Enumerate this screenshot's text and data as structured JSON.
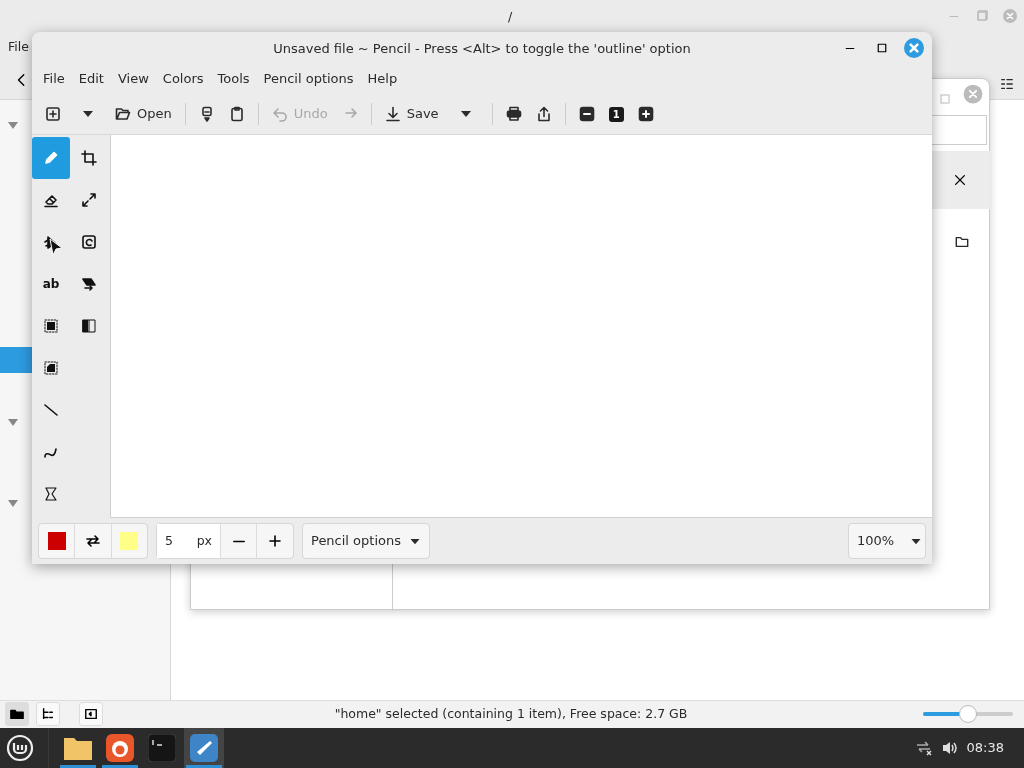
{
  "background_window": {
    "title": "/",
    "menu": [
      "File"
    ],
    "status_text": "\"home\" selected (containing 1 item), Free space: 2.7 GB",
    "zoom_slider": {
      "level": 0.5
    }
  },
  "pencil_window": {
    "title": "Unsaved file ~ Pencil - Press <Alt> to toggle the 'outline' option",
    "menu": [
      "File",
      "Edit",
      "View",
      "Colors",
      "Tools",
      "Pencil options",
      "Help"
    ],
    "toolbar": [
      {
        "kind": "button",
        "disabled": false
      },
      {
        "kind": "caret",
        "disabled": false
      },
      {
        "kind": "button",
        "label": "Open",
        "disabled": false
      },
      {
        "kind": "separator"
      },
      {
        "kind": "button",
        "disabled": false
      },
      {
        "kind": "button",
        "disabled": false
      },
      {
        "kind": "separator"
      },
      {
        "kind": "button",
        "label": "Undo",
        "disabled": true
      },
      {
        "kind": "button",
        "disabled": true
      },
      {
        "kind": "separator"
      },
      {
        "kind": "button",
        "label": "Save",
        "disabled": false
      },
      {
        "kind": "caret",
        "disabled": false
      },
      {
        "kind": "separator"
      },
      {
        "kind": "button",
        "disabled": false
      },
      {
        "kind": "button",
        "disabled": false
      },
      {
        "kind": "separator"
      },
      {
        "kind": "button",
        "disabled": false
      },
      {
        "kind": "button",
        "label": "1",
        "disabled": false
      },
      {
        "kind": "button",
        "disabled": false
      }
    ],
    "tools": [
      {
        "selected": true
      },
      {
        "selected": false
      },
      {
        "selected": false
      },
      {
        "selected": false
      },
      {
        "selected": false
      },
      {
        "selected": false
      },
      {
        "label": "ab",
        "selected": false
      },
      {
        "selected": false
      },
      {
        "selected": false
      },
      {
        "selected": false
      },
      {
        "selected": false
      },
      {
        "selected": false
      },
      {
        "selected": false
      },
      {
        "selected": false
      }
    ],
    "main_color": {
      "color": "#cc0000"
    },
    "secondary_color": {
      "color": "#ffff88"
    },
    "size": {
      "value": "5",
      "unit": "px"
    },
    "options": "Pencil options",
    "zoom": "100%"
  },
  "taskbar": {
    "apps": [
      {
        "running": true,
        "active": false
      },
      {
        "running": true,
        "active": false
      },
      {
        "running": false,
        "active": false
      },
      {
        "running": true,
        "active": true
      }
    ],
    "clock": "08:38"
  }
}
